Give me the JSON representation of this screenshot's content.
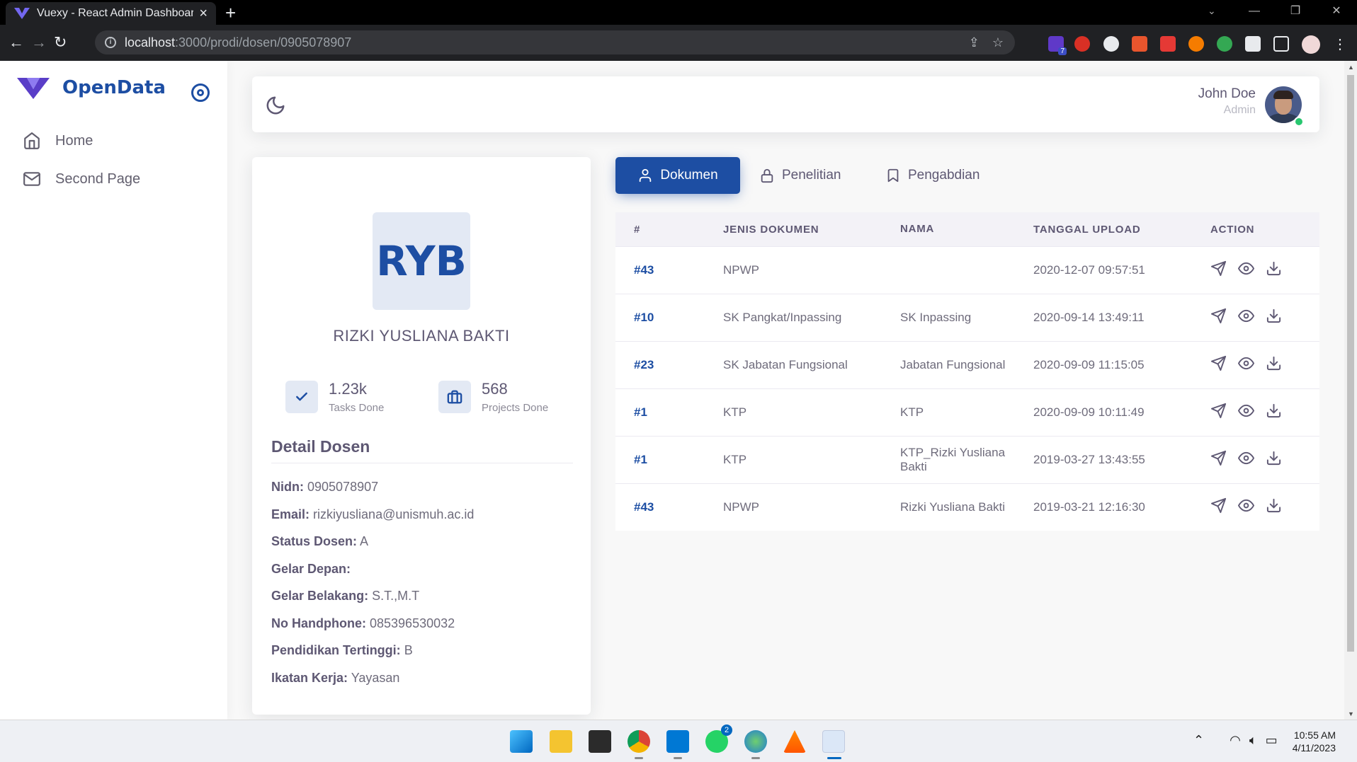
{
  "browser": {
    "tab_title": "Vuexy - React Admin Dashboard",
    "url_host": "localhost",
    "url_path": ":3000/prodi/dosen/0905078907"
  },
  "sidebar": {
    "brand": "OpenData",
    "items": [
      {
        "label": "Home",
        "icon": "home-icon"
      },
      {
        "label": "Second Page",
        "icon": "mail-icon"
      }
    ]
  },
  "navbar": {
    "user_name": "John Doe",
    "user_role": "Admin"
  },
  "profile": {
    "initials": "RYB",
    "name": "RIZKI YUSLIANA BAKTI",
    "stats": [
      {
        "value": "1.23k",
        "label": "Tasks Done",
        "icon": "check-icon"
      },
      {
        "value": "568",
        "label": "Projects Done",
        "icon": "briefcase-icon"
      }
    ],
    "detail_title": "Detail Dosen",
    "details": [
      {
        "label": "Nidn:",
        "value": "0905078907"
      },
      {
        "label": "Email:",
        "value": "rizkiyusliana@unismuh.ac.id"
      },
      {
        "label": "Status Dosen:",
        "value": "A"
      },
      {
        "label": "Gelar Depan:",
        "value": ""
      },
      {
        "label": "Gelar Belakang:",
        "value": "S.T.,M.T"
      },
      {
        "label": "No Handphone:",
        "value": "085396530032"
      },
      {
        "label": "Pendidikan Tertinggi:",
        "value": "B"
      },
      {
        "label": "Ikatan Kerja:",
        "value": "Yayasan"
      }
    ]
  },
  "tabs": [
    {
      "label": "Dokumen",
      "icon": "user-icon",
      "active": true
    },
    {
      "label": "Penelitian",
      "icon": "lock-icon",
      "active": false
    },
    {
      "label": "Pengabdian",
      "icon": "bookmark-icon",
      "active": false
    }
  ],
  "table": {
    "headers": [
      "#",
      "JENIS DOKUMEN",
      "NAMA",
      "TANGGAL UPLOAD",
      "ACTION"
    ],
    "rows": [
      {
        "id": "#43",
        "jenis": "NPWP",
        "nama": "",
        "tanggal": "2020-12-07 09:57:51"
      },
      {
        "id": "#10",
        "jenis": "SK Pangkat/Inpassing",
        "nama": "SK Inpassing",
        "tanggal": "2020-09-14 13:49:11"
      },
      {
        "id": "#23",
        "jenis": "SK Jabatan Fungsional",
        "nama": "Jabatan Fungsional",
        "tanggal": "2020-09-09 11:15:05"
      },
      {
        "id": "#1",
        "jenis": "KTP",
        "nama": "KTP",
        "tanggal": "2020-09-09 10:11:49"
      },
      {
        "id": "#1",
        "jenis": "KTP",
        "nama": "KTP_Rizki Yusliana Bakti",
        "tanggal": "2019-03-27 13:43:55"
      },
      {
        "id": "#43",
        "jenis": "NPWP",
        "nama": "Rizki Yusliana Bakti",
        "tanggal": "2019-03-21 12:16:30"
      }
    ]
  },
  "taskbar": {
    "time": "10:55 AM",
    "date": "4/11/2023",
    "badges": {
      "extension_count": "7",
      "whatsapp_count": "2"
    }
  },
  "colors": {
    "primary": "#1d4ea3",
    "success": "#28c76f",
    "text": "#6e6b7b",
    "heading": "#5e5873"
  }
}
